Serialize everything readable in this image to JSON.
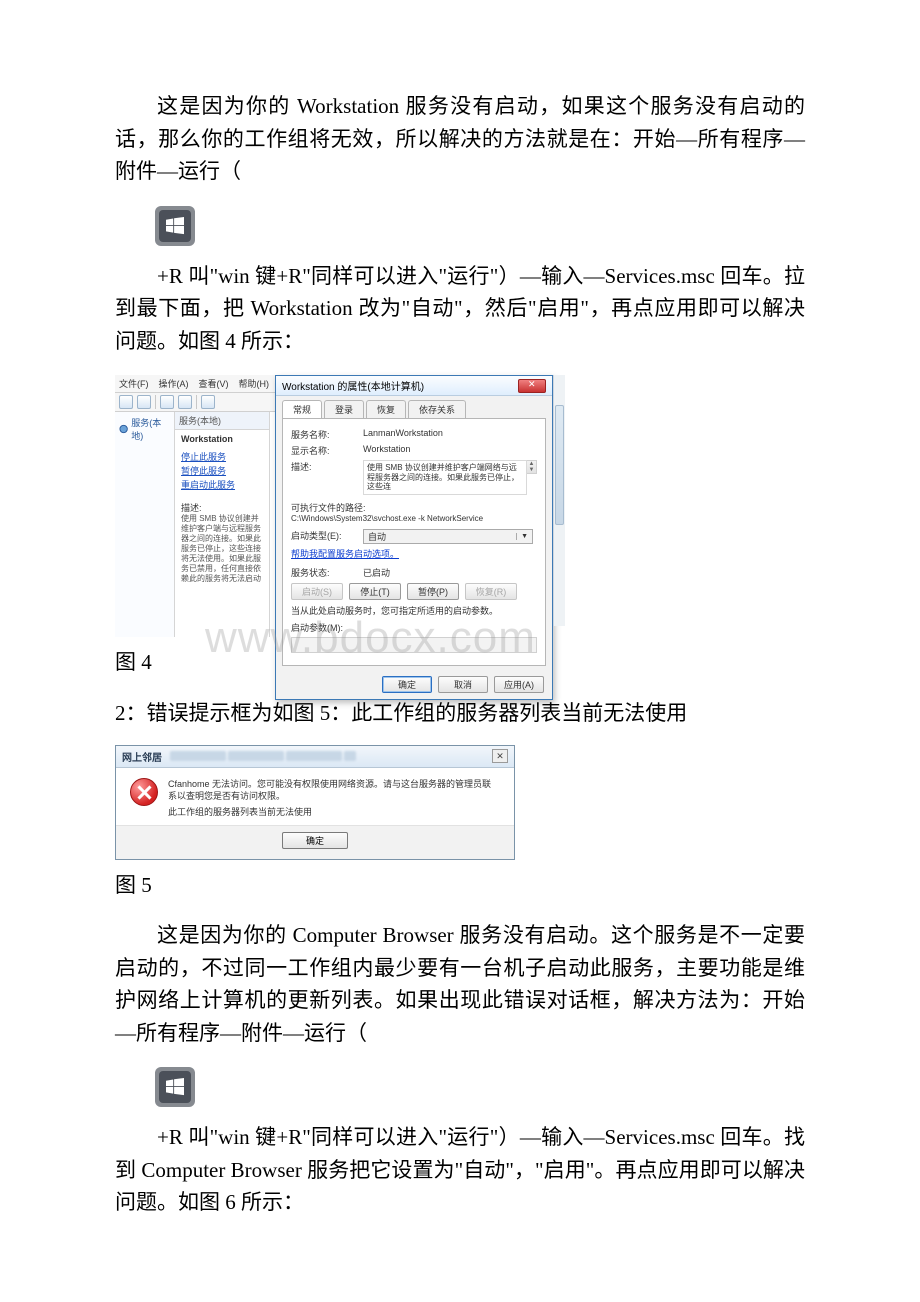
{
  "para1": "这是因为你的 Workstation 服务没有启动，如果这个服务没有启动的话，那么你的工作组将无效，所以解决的方法就是在：开始—所有程序—附件—运行（",
  "para2": "+R 叫\"win 键+R\"同样可以进入\"运行\"）—输入—Services.msc 回车。拉到最下面，把 Workstation 改为\"自动\"，然后\"启用\"，再点应用即可以解决问题。如图 4 所示：",
  "fig4_caption": "图 4",
  "heading2": "2：错误提示框为如图 5：此工作组的服务器列表当前无法使用",
  "fig5_caption": "图 5",
  "para3": "这是因为你的 Computer Browser 服务没有启动。这个服务是不一定要启动的，不过同一工作组内最少要有一台机子启动此服务，主要功能是维护网络上计算机的更新列表。如果出现此错误对话框，解决方法为：开始—所有程序—附件—运行（",
  "para4": "+R 叫\"win 键+R\"同样可以进入\"运行\"）—输入—Services.msc 回车。找到 Computer Browser 服务把它设置为\"自动\"，\"启用\"。再点应用即可以解决问题。如图 6 所示：",
  "watermark": "www.bdocx.com",
  "svc": {
    "menu": {
      "file": "文件(F)",
      "action": "操作(A)",
      "view": "查看(V)",
      "help": "帮助(H)"
    },
    "tree_item": "服务(本地)",
    "panel_header": "服务(本地)",
    "service_name": "Workstation",
    "links": {
      "stop": "停止此服务",
      "pause": "暂停此服务",
      "restart": "重启动此服务"
    },
    "desc_label": "描述:",
    "desc_text": "使用 SMB 协议创建并维护客户端与远程服务器之间的连接。如果此服务已停止，这些连接将无法使用。如果此服务已禁用，任何直接依赖此的服务将无法启动",
    "dialog": {
      "title": "Workstation 的属性(本地计算机)",
      "tabs": {
        "general": "常规",
        "logon": "登录",
        "recovery": "恢复",
        "deps": "依存关系"
      },
      "rows": {
        "svc_name_lbl": "服务名称:",
        "svc_name_val": "LanmanWorkstation",
        "disp_name_lbl": "显示名称:",
        "disp_name_val": "Workstation",
        "desc_lbl": "描述:",
        "desc_val": "使用 SMB 协议创建并维护客户端网络与远程服务器之间的连接。如果此服务已停止，这些连",
        "exe_lbl": "可执行文件的路径:",
        "exe_val": "C:\\Windows\\System32\\svchost.exe -k NetworkService",
        "start_lbl": "启动类型(E):",
        "start_val": "自动",
        "help_link": "帮助我配置服务启动选项。",
        "status_lbl": "服务状态:",
        "status_val": "已启动",
        "btn_start": "启动(S)",
        "btn_stop": "停止(T)",
        "btn_pause": "暂停(P)",
        "btn_resume": "恢复(R)",
        "hint": "当从此处启动服务时，您可指定所适用的启动参数。",
        "param_lbl": "启动参数(M):",
        "ok": "确定",
        "cancel": "取消",
        "apply": "应用(A)"
      }
    }
  },
  "nb": {
    "title": "网上邻居",
    "line1": "Cfanhome 无法访问。您可能没有权限使用网络资源。请与这台服务器的管理员联系以查明您是否有访问权限。",
    "line2": "此工作组的服务器列表当前无法使用",
    "ok": "确定"
  }
}
